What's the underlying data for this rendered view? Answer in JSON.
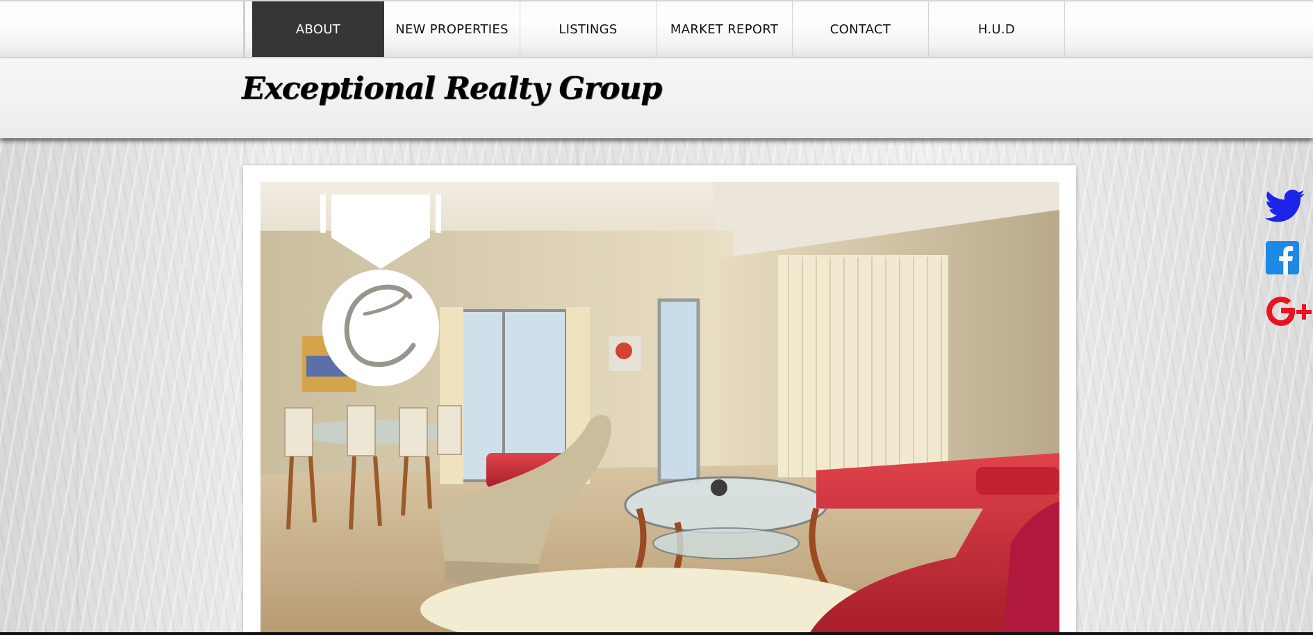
{
  "nav": {
    "items": [
      {
        "label": "ABOUT",
        "active": true
      },
      {
        "label": "NEW PROPERTIES",
        "active": false
      },
      {
        "label": "LISTINGS",
        "active": false
      },
      {
        "label": "MARKET REPORT",
        "active": false
      },
      {
        "label": "CONTACT",
        "active": false
      },
      {
        "label": "H.U.D",
        "active": false
      }
    ]
  },
  "header": {
    "site_title": "Exceptional Realty Group"
  },
  "hero": {
    "subject": "living-room-photo",
    "logo_icon": "medal-e-icon"
  },
  "social": {
    "items": [
      {
        "icon": "twitter-icon",
        "color": "#1d24e8"
      },
      {
        "icon": "facebook-icon",
        "color": "#1e88e5"
      },
      {
        "icon": "google-plus-icon",
        "color": "#e8141f"
      }
    ]
  },
  "colors": {
    "nav_active_bg": "#363636",
    "nav_active_text": "#ffffff"
  }
}
